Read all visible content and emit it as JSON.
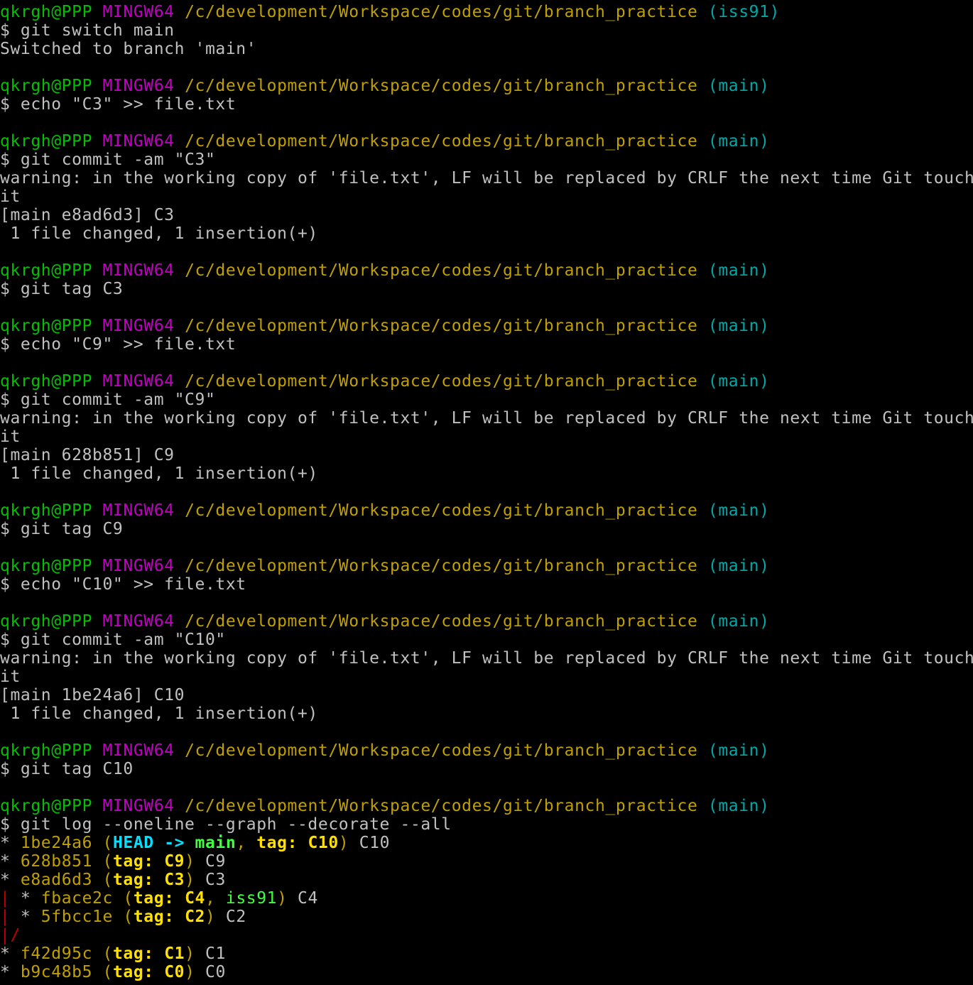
{
  "prompt_user": "qkrgh@PPP",
  "prompt_system": "MINGW64",
  "prompt_path": "/c/development/Workspace/codes/git/branch_practice",
  "prompt_symbol": "$",
  "blocks": [
    {
      "branch": "(iss91)",
      "command": "git switch main",
      "output": [
        "Switched to branch 'main'"
      ]
    },
    {
      "branch": "(main)",
      "command": "echo \"C3\" >> file.txt",
      "output": []
    },
    {
      "branch": "(main)",
      "command": "git commit -am \"C3\"",
      "output": [
        "warning: in the working copy of 'file.txt', LF will be replaced by CRLF the next time Git touches",
        "it",
        "[main e8ad6d3] C3",
        " 1 file changed, 1 insertion(+)"
      ]
    },
    {
      "branch": "(main)",
      "command": "git tag C3",
      "output": []
    },
    {
      "branch": "(main)",
      "command": "echo \"C9\" >> file.txt",
      "output": []
    },
    {
      "branch": "(main)",
      "command": "git commit -am \"C9\"",
      "output": [
        "warning: in the working copy of 'file.txt', LF will be replaced by CRLF the next time Git touches",
        "it",
        "[main 628b851] C9",
        " 1 file changed, 1 insertion(+)"
      ]
    },
    {
      "branch": "(main)",
      "command": "git tag C9",
      "output": []
    },
    {
      "branch": "(main)",
      "command": "echo \"C10\" >> file.txt",
      "output": []
    },
    {
      "branch": "(main)",
      "command": "git commit -am \"C10\"",
      "output": [
        "warning: in the working copy of 'file.txt', LF will be replaced by CRLF the next time Git touches",
        "it",
        "[main 1be24a6] C10",
        " 1 file changed, 1 insertion(+)"
      ]
    },
    {
      "branch": "(main)",
      "command": "git tag C10",
      "output": []
    },
    {
      "branch": "(main)",
      "command": "git log --oneline --graph --decorate --all",
      "output": []
    }
  ],
  "log": [
    {
      "graph": "* ",
      "graph_red": "",
      "hash": "1be24a6",
      "refs": [
        {
          "text": "HEAD -> ",
          "kind": "head"
        },
        {
          "text": "main",
          "kind": "main"
        },
        {
          "text": ", ",
          "kind": "paren"
        },
        {
          "text": "tag: C10",
          "kind": "tag"
        }
      ],
      "msg": "C10"
    },
    {
      "graph": "* ",
      "graph_red": "",
      "hash": "628b851",
      "refs": [
        {
          "text": "tag: C9",
          "kind": "tag"
        }
      ],
      "msg": "C9"
    },
    {
      "graph": "* ",
      "graph_red": "",
      "hash": "e8ad6d3",
      "refs": [
        {
          "text": "tag: C3",
          "kind": "tag"
        }
      ],
      "msg": "C3"
    },
    {
      "graph": " * ",
      "graph_red": "|",
      "hash": "fbace2c",
      "refs": [
        {
          "text": "tag: C4",
          "kind": "tag"
        },
        {
          "text": ", ",
          "kind": "paren"
        },
        {
          "text": "iss91",
          "kind": "brname"
        }
      ],
      "msg": "C4"
    },
    {
      "graph": " * ",
      "graph_red": "|",
      "hash": "5fbcc1e",
      "refs": [
        {
          "text": "tag: C2",
          "kind": "tag"
        }
      ],
      "msg": "C2"
    },
    {
      "graph": "",
      "graph_red": "|/",
      "hash": "",
      "refs": [],
      "msg": ""
    },
    {
      "graph": "* ",
      "graph_red": "",
      "hash": "f42d95c",
      "refs": [
        {
          "text": "tag: C1",
          "kind": "tag"
        }
      ],
      "msg": "C1"
    },
    {
      "graph": "* ",
      "graph_red": "",
      "hash": "b9c48b5",
      "refs": [
        {
          "text": "tag: C0",
          "kind": "tag"
        }
      ],
      "msg": "C0"
    }
  ],
  "colors": {
    "background": "#000000",
    "user": "#00c000",
    "system": "#c000c0",
    "path": "#c0a000",
    "branch": "#00a8a8",
    "text": "#c0c0c0",
    "tag": "#ffe000",
    "head": "#00e0ff",
    "branch_ref": "#40ff40",
    "graph_line": "#c00000"
  }
}
